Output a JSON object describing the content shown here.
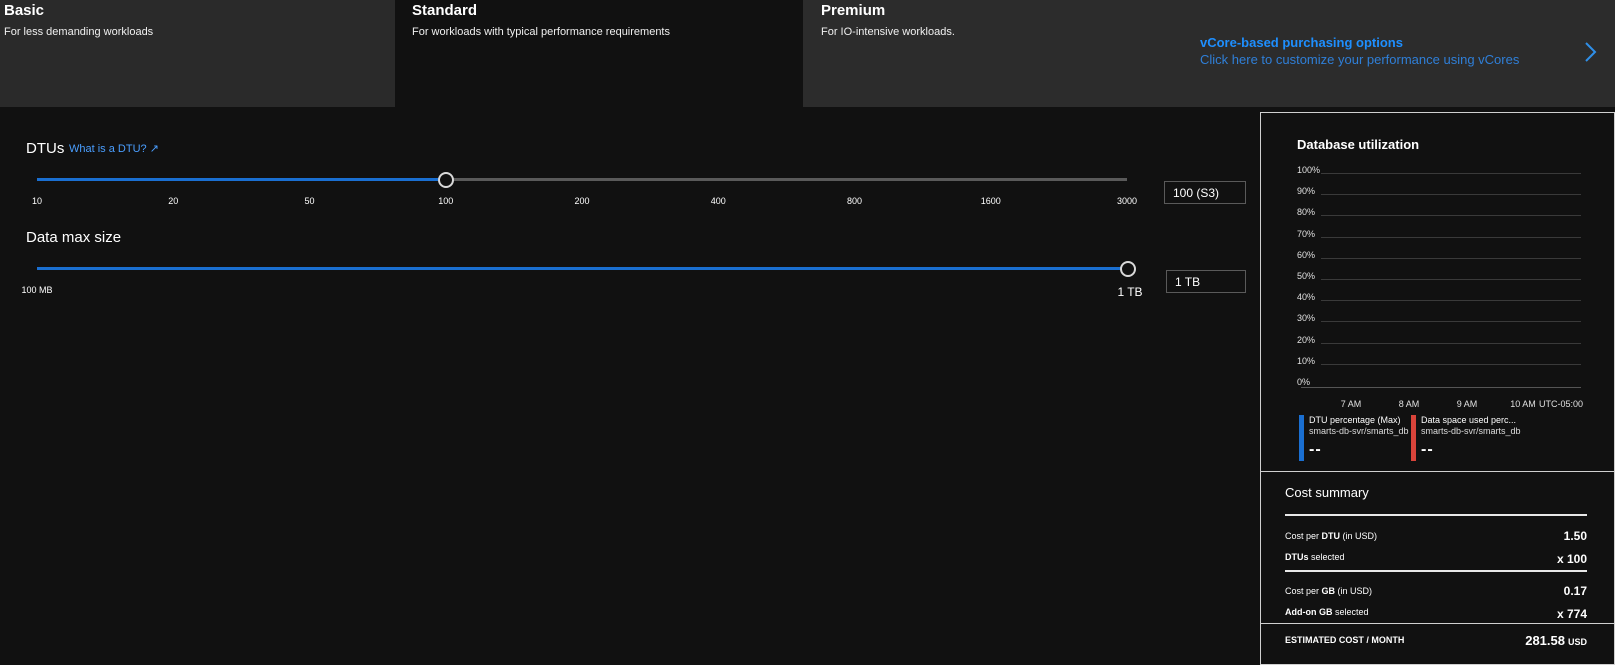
{
  "tiers": [
    {
      "title": "Basic",
      "desc": "For less demanding workloads"
    },
    {
      "title": "Standard",
      "desc": "For workloads with typical performance requirements"
    },
    {
      "title": "Premium",
      "desc": "For IO-intensive workloads."
    }
  ],
  "vcore": {
    "title": "vCore-based purchasing options",
    "subtitle": "Click here to customize your performance using vCores"
  },
  "dtu": {
    "label": "DTUs",
    "link": "What is a DTU? ↗",
    "ticks": [
      "10",
      "20",
      "50",
      "100",
      "200",
      "400",
      "800",
      "1600",
      "3000"
    ],
    "selected_fraction": 0.375,
    "value": "100 (S3)"
  },
  "datasize": {
    "label": "Data max size",
    "min_label": "100 MB",
    "max_label": "1 TB",
    "selected_fraction": 1.0,
    "value": "1 TB"
  },
  "utilization": {
    "title": "Database utilization",
    "yticks": [
      "100%",
      "90%",
      "80%",
      "70%",
      "60%",
      "50%",
      "40%",
      "30%",
      "20%",
      "10%",
      "0%"
    ],
    "xticks": [
      "7 AM",
      "8 AM",
      "9 AM",
      "10 AM",
      "UTC-05:00"
    ],
    "legend": [
      {
        "name": "DTU percentage (Max)",
        "resource": "smarts-db-svr/smarts_db",
        "value": "--",
        "color": "#1a6fd1"
      },
      {
        "name": "Data space used perc...",
        "resource": "smarts-db-svr/smarts_db",
        "value": "--",
        "color": "#d9443a"
      }
    ]
  },
  "cost": {
    "title": "Cost summary",
    "per_dtu_label_pre": "Cost per ",
    "per_dtu_label_bold": "DTU",
    "per_dtu_label_post": " (in USD)",
    "per_dtu_value": "1.50",
    "dtus_selected_bold": "DTUs",
    "dtus_selected_post": " selected",
    "dtus_selected_value": "x 100",
    "per_gb_label_pre": "Cost per ",
    "per_gb_label_bold": "GB",
    "per_gb_label_post": " (in USD)",
    "per_gb_value": "0.17",
    "addon_bold": "Add-on GB",
    "addon_post": " selected",
    "addon_value": "x 774",
    "estimated_label": "ESTIMATED COST / MONTH",
    "estimated_value": "281.58",
    "currency": "USD"
  }
}
